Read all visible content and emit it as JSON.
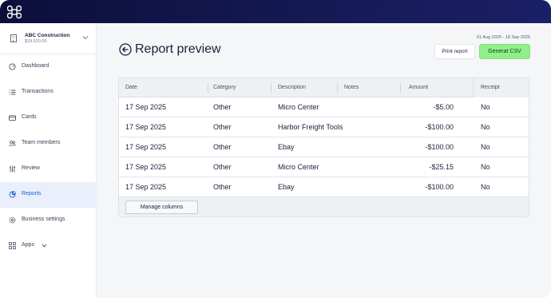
{
  "company": {
    "name": "ABC Construction",
    "balance": "$29,520.00"
  },
  "nav": [
    {
      "label": "Dashboard",
      "icon": "dashboard-icon"
    },
    {
      "label": "Transactions",
      "icon": "list-icon"
    },
    {
      "label": "Cards",
      "icon": "card-icon"
    },
    {
      "label": "Team members",
      "icon": "people-icon"
    },
    {
      "label": "Review",
      "icon": "sliders-icon"
    },
    {
      "label": "Reports",
      "icon": "reports-icon",
      "active": true
    },
    {
      "label": "Business settings",
      "icon": "gear-icon"
    },
    {
      "label": "Apps",
      "icon": "grid-icon"
    }
  ],
  "page": {
    "title": "Report preview",
    "date_range": "01 Aug 2025 - 18 Sep 2025"
  },
  "actions": {
    "print_label": "Print report",
    "csv_label": "Generat CSV"
  },
  "table": {
    "columns": [
      "Date",
      "Category",
      "Description",
      "Notes",
      "Amount",
      "Receipt"
    ],
    "rows": [
      {
        "date": "17 Sep 2025",
        "category": "Other",
        "description": "Micro Center",
        "notes": "",
        "amount": "-$5.00",
        "receipt": "No"
      },
      {
        "date": "17 Sep 2025",
        "category": "Other",
        "description": "Harbor Freight Tools",
        "notes": "",
        "amount": "-$100.00",
        "receipt": "No"
      },
      {
        "date": "17 Sep 2025",
        "category": "Other",
        "description": "Ebay",
        "notes": "",
        "amount": "-$100.00",
        "receipt": "No"
      },
      {
        "date": "17 Sep 2025",
        "category": "Other",
        "description": "Micro Center",
        "notes": "",
        "amount": "-$25.15",
        "receipt": "No"
      },
      {
        "date": "17 Sep 2025",
        "category": "Other",
        "description": "Ebay",
        "notes": "",
        "amount": "-$100.00",
        "receipt": "No"
      }
    ],
    "manage_label": "Manage columns"
  },
  "colors": {
    "accent_green": "#8ff08a",
    "active_blue": "#1b5fd1",
    "topbar": "#0c0f3a"
  }
}
